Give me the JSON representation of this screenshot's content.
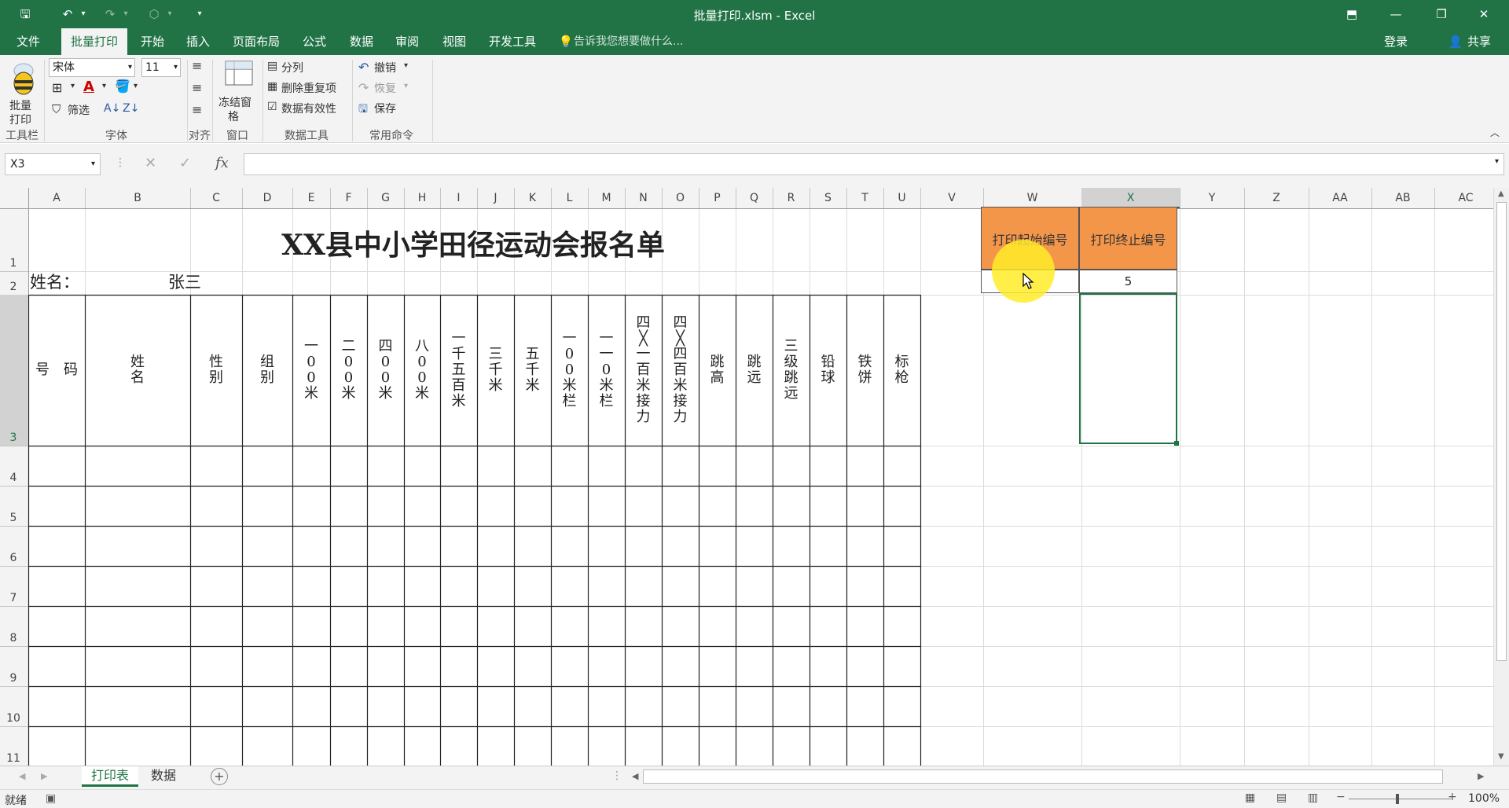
{
  "window": {
    "title": "批量打印.xlsm - Excel"
  },
  "menu": {
    "tabs": [
      "文件",
      "批量打印",
      "开始",
      "插入",
      "页面布局",
      "公式",
      "数据",
      "审阅",
      "视图",
      "开发工具"
    ],
    "tell_me": "告诉我您想要做什么...",
    "login": "登录",
    "share": "共享"
  },
  "ribbon": {
    "batch_print_label_1": "批量",
    "batch_print_label_2": "打印",
    "font_name": "宋体",
    "font_size": "11",
    "filter": "筛选",
    "freeze_1": "冻结窗",
    "freeze_2": "格",
    "split": "分列",
    "remove_dup": "删除重复项",
    "validation": "数据有效性",
    "undo": "撤销",
    "redo": "恢复",
    "save": "保存",
    "groups": {
      "toolbar": "工具栏",
      "font": "字体",
      "align": "对齐",
      "window": "窗口",
      "data_tools": "数据工具",
      "common": "常用命令"
    }
  },
  "formula_bar": {
    "name_box": "X3",
    "formula": ""
  },
  "columns": [
    "A",
    "B",
    "C",
    "D",
    "E",
    "F",
    "G",
    "H",
    "I",
    "J",
    "K",
    "L",
    "M",
    "N",
    "O",
    "P",
    "Q",
    "R",
    "S",
    "T",
    "U",
    "V",
    "W",
    "X",
    "Y",
    "Z",
    "AA",
    "AB",
    "AC"
  ],
  "rows": [
    "1",
    "2",
    "3",
    "4",
    "5",
    "6",
    "7",
    "8",
    "9",
    "10",
    "11"
  ],
  "sheet": {
    "title": "XX县中小学田径运动会报名单",
    "name_label": "姓名：",
    "name_value": "张三",
    "headers": [
      "号　码",
      "姓\n名",
      "性\n别",
      "组\n别",
      "一\n0\n0\n米",
      "二\n0\n0\n米",
      "四\n0\n0\n米",
      "八\n0\n0\n米",
      "一\n千\n五\n百\n米",
      "三\n千\n米",
      "五\n千\n米",
      "一\n0\n0\n米\n栏",
      "一\n一\n0\n米\n栏",
      "四\n╳\n一\n百\n米\n接\n力",
      "四\n╳\n四\n百\n米\n接\n力",
      "跳\n高",
      "跳\n远",
      "三\n级\n跳\n远",
      "铅\n球",
      "铁\n饼",
      "标\n枪"
    ],
    "print_start_label": "打印起始编号",
    "print_end_label": "打印终止编号",
    "print_start_value": "",
    "print_end_value": "5"
  },
  "sheets": {
    "tabs": [
      "打印表",
      "数据"
    ],
    "active": "打印表"
  },
  "status": {
    "ready": "就绪",
    "zoom": "100%"
  },
  "colors": {
    "accent": "#217346",
    "orange": "#f4964a",
    "highlight": "#ffef3a"
  }
}
